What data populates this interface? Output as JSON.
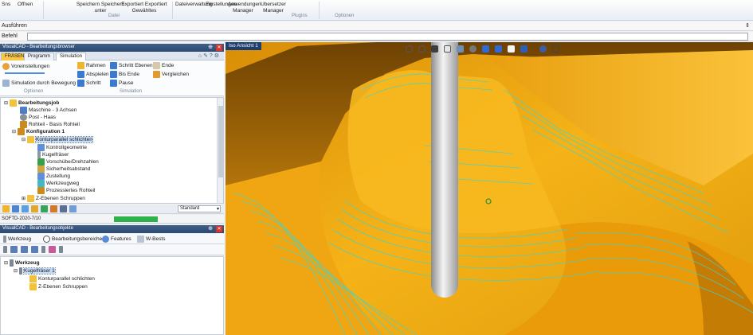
{
  "ribbon": {
    "items": [
      "Sns",
      "Offnen",
      "Speichern Speichern unter",
      "Exportiert Exportiert Gewähltes",
      "Dateiverwaltung",
      "Einstellungen",
      "Anwendungen Manager",
      "Ubersetzer Manager"
    ],
    "groups": [
      "Datei",
      "Plugins",
      "Optionen"
    ]
  },
  "bars": {
    "row1_label": "Ausführen",
    "row2_label": "Befehl",
    "command_value": ""
  },
  "machining_panel": {
    "title": "VisualCAD - Bearbeitungsbrowser",
    "tabs": [
      "FRÄSEN",
      "Programm",
      "Simulation"
    ],
    "ribbon": {
      "left": [
        "Voreinstellungen",
        "Simulation durch Bewegung"
      ],
      "col2": [
        "Rahmen",
        "Abspielen",
        "Schritt"
      ],
      "col3": [
        "Schritt Ebenen",
        "Bis Ende",
        "Pause"
      ],
      "col4": [
        "Ende",
        "Vergleichen"
      ],
      "groups": [
        "Optionen",
        "Simulation"
      ]
    },
    "tree": [
      "Bearbeitungsjob",
      "Maschine - 3 Achsen",
      "Post - Haas",
      "Rohteil - Basis Rohteil",
      "Konfiguration 1",
      "Konturparallel schlichten",
      "Kontrollgeometrie",
      "Kugelfräser",
      "Vorschübe/Drehzahlen",
      "Sicherheitsabstand",
      "Zustellung",
      "Werkzeugweg",
      "Prozessiertes Rohteil",
      "Z-Ebenen Schruppen"
    ],
    "dropdown_value": "Standard",
    "status_text": "SOFTD-2020-7/10"
  },
  "tool_panel": {
    "title": "VisualCAD - Bearbeitungsobjekte",
    "tabs": [
      "Werkzeug",
      "Bearbeitungsbereiche",
      "Features",
      "W-Bests"
    ],
    "tree": [
      "Werkzeug",
      "Kugelfräser 1",
      "Konturparallel schlichten",
      "Z-Ebenen Schruppen"
    ]
  },
  "viewport": {
    "title": "Iso Ansicht 1"
  },
  "colors": {
    "part": "#f2a90b",
    "toolpath": "#3cd6d0",
    "title_bar": "#2c4a72"
  }
}
